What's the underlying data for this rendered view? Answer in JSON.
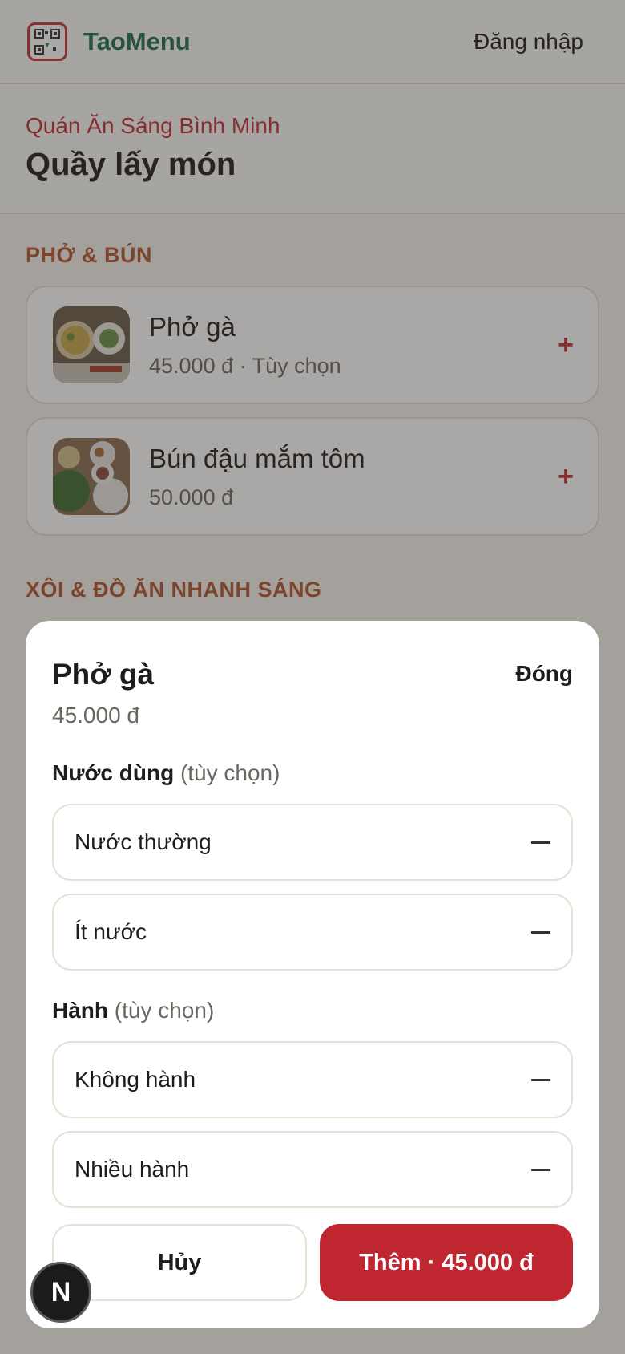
{
  "header": {
    "brand": "TaoMenu",
    "login": "Đăng nhập"
  },
  "venue": {
    "name": "Quán Ăn Sáng Bình Minh",
    "title": "Quầy lấy món"
  },
  "sections": [
    {
      "title": "PHỞ & BÚN",
      "items": [
        {
          "name": "Phở gà",
          "price": "45.000 đ · Tùy chọn",
          "action": "+"
        },
        {
          "name": "Bún đậu mắm tôm",
          "price": "50.000 đ",
          "action": "+"
        }
      ]
    },
    {
      "title": "XÔI & ĐỒ ĂN NHANH SÁNG"
    }
  ],
  "modal": {
    "title": "Phở gà",
    "close": "Đóng",
    "price": "45.000 đ",
    "groups": [
      {
        "label": "Nước dùng",
        "hint": "(tùy chọn)",
        "options": [
          "Nước thường",
          "Ít nước"
        ]
      },
      {
        "label": "Hành",
        "hint": "(tùy chọn)",
        "options": [
          "Không hành",
          "Nhiều hành"
        ]
      }
    ],
    "cancel": "Hủy",
    "add": "Thêm · 45.000 đ"
  },
  "fab": {
    "letter": "N"
  },
  "colors": {
    "accent": "#bf2630",
    "brand": "#1f6b4c",
    "section": "#b2542c"
  }
}
